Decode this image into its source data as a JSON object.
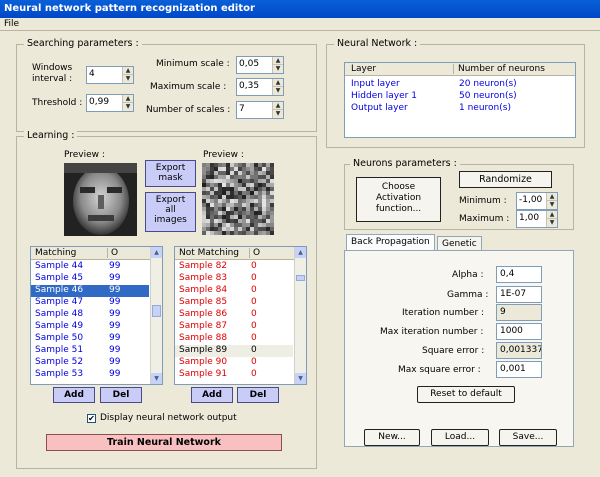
{
  "window": {
    "title": "Neural network pattern recognization editor"
  },
  "menu": {
    "file": "File"
  },
  "search": {
    "legend": "Searching parameters :",
    "windows_interval_label_1": "Windows",
    "windows_interval_label_2": "interval :",
    "windows_interval": "4",
    "threshold_label": "Threshold :",
    "threshold": "0,99",
    "min_scale_label": "Minimum scale :",
    "min_scale": "0,05",
    "max_scale_label": "Maximum scale :",
    "max_scale": "0,35",
    "num_scales_label": "Number of scales :",
    "num_scales": "7"
  },
  "learning": {
    "legend": "Learning :",
    "preview1_label": "Preview :",
    "preview2_label": "Preview :",
    "export_mask_1": "Export",
    "export_mask_2": "mask",
    "export_all_1": "Export",
    "export_all_2": "all",
    "export_all_3": "images",
    "matching": {
      "col1": "Matching",
      "col2": "O",
      "rows": [
        {
          "name": "Sample 44",
          "o": "99"
        },
        {
          "name": "Sample 45",
          "o": "99"
        },
        {
          "name": "Sample 46",
          "o": "99"
        },
        {
          "name": "Sample 47",
          "o": "99"
        },
        {
          "name": "Sample 48",
          "o": "99"
        },
        {
          "name": "Sample 49",
          "o": "99"
        },
        {
          "name": "Sample 50",
          "o": "99"
        },
        {
          "name": "Sample 51",
          "o": "99"
        },
        {
          "name": "Sample 52",
          "o": "99"
        },
        {
          "name": "Sample 53",
          "o": "99"
        }
      ]
    },
    "not_matching": {
      "col1": "Not Matching",
      "col2": "O",
      "rows": [
        {
          "name": "Sample 82",
          "o": "0"
        },
        {
          "name": "Sample 83",
          "o": "0"
        },
        {
          "name": "Sample 84",
          "o": "0"
        },
        {
          "name": "Sample 85",
          "o": "0"
        },
        {
          "name": "Sample 86",
          "o": "0"
        },
        {
          "name": "Sample 87",
          "o": "0"
        },
        {
          "name": "Sample 88",
          "o": "0"
        },
        {
          "name": "Sample 89",
          "o": "0"
        },
        {
          "name": "Sample 90",
          "o": "0"
        },
        {
          "name": "Sample 91",
          "o": "0"
        }
      ]
    },
    "add_label": "Add",
    "del_label": "Del",
    "add2_label": "Add",
    "del2_label": "Del",
    "display_output_label": "Display neural network output",
    "display_output_checked": true,
    "train_label": "Train Neural Network"
  },
  "network": {
    "legend": "Neural Network :",
    "col_layer": "Layer",
    "col_neurons": "Number of neurons",
    "layers": [
      {
        "name": "Input layer",
        "neurons": "20 neuron(s)"
      },
      {
        "name": "Hidden layer 1",
        "neurons": "50 neuron(s)"
      },
      {
        "name": "Output layer",
        "neurons": "1 neuron(s)"
      }
    ]
  },
  "neurons": {
    "legend": "Neurons parameters :",
    "choose_1": "Choose",
    "choose_2": "Activation",
    "choose_3": "function...",
    "randomize": "Randomize",
    "minimum_label": "Minimum :",
    "minimum": "-1,00",
    "maximum_label": "Maximum :",
    "maximum": "1,00"
  },
  "tabs": {
    "backprop": "Back Propagation",
    "genetic": "Genetic"
  },
  "bp": {
    "alpha_label": "Alpha :",
    "alpha": "0,4",
    "gamma_label": "Gamma :",
    "gamma": "1E-07",
    "iteration_label": "Iteration number :",
    "iteration": "9",
    "max_iteration_label": "Max iteration number :",
    "max_iteration": "1000",
    "square_error_label": "Square error :",
    "square_error": "0,001337",
    "max_square_error_label": "Max square error :",
    "max_square_error": "0,001",
    "reset_label": "Reset to default"
  },
  "actions": {
    "new": "New...",
    "load": "Load...",
    "save": "Save..."
  },
  "colors": {
    "title_bar": "#0a5fd8",
    "selected_row": "#316ac5",
    "train_button": "#f8c0c0",
    "pos": "#0000e0",
    "neg": "#e00000"
  }
}
